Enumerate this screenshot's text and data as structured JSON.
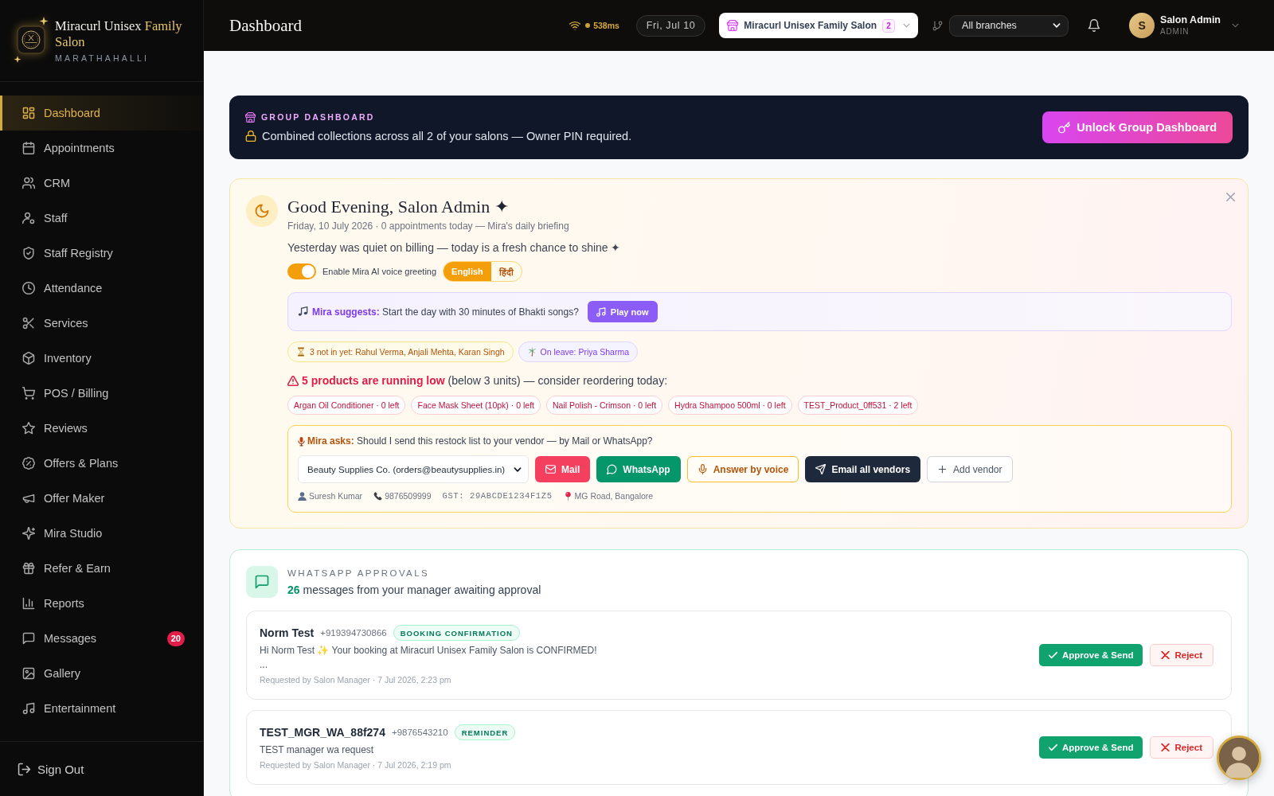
{
  "sidebar": {
    "brand": {
      "name": "Miracurl Unisex",
      "name_accent": "Family Salon",
      "location": "MARATHAHALLI"
    },
    "items": [
      {
        "label": "Dashboard",
        "selected": true
      },
      {
        "label": "Appointments",
        "selected": false
      },
      {
        "label": "CRM",
        "selected": false
      },
      {
        "label": "Staff",
        "selected": false
      },
      {
        "label": "Staff Registry",
        "selected": false
      },
      {
        "label": "Attendance",
        "selected": false
      },
      {
        "label": "Services",
        "selected": false
      },
      {
        "label": "Inventory",
        "selected": false
      },
      {
        "label": "POS / Billing",
        "selected": false
      },
      {
        "label": "Reviews",
        "selected": false
      },
      {
        "label": "Offers & Plans",
        "selected": false
      },
      {
        "label": "Offer Maker",
        "selected": false
      },
      {
        "label": "Mira Studio",
        "selected": false
      },
      {
        "label": "Refer & Earn",
        "selected": false
      },
      {
        "label": "Reports",
        "selected": false
      },
      {
        "label": "Messages",
        "selected": false,
        "badge": "20"
      },
      {
        "label": "Gallery",
        "selected": false
      },
      {
        "label": "Entertainment",
        "selected": false
      }
    ],
    "sign_out": "Sign Out"
  },
  "header": {
    "title": "Dashboard",
    "latency": "538ms",
    "date": "Fri, Jul 10",
    "salon": {
      "name": "Miracurl Unisex Family Salon",
      "count": "2"
    },
    "branch": "All branches",
    "user": {
      "initial": "S",
      "name": "Salon Admin",
      "role": "ADMIN"
    }
  },
  "group_banner": {
    "label": "GROUP DASHBOARD",
    "text": "Combined collections across all 2 of your salons — Owner PIN required.",
    "button": "Unlock Group Dashboard"
  },
  "briefing": {
    "title": "Good Evening, Salon Admin ✦",
    "subtitle": "Friday, 10 July 2026 · 0 appointments today — Mira's daily briefing",
    "message": "Yesterday was quiet on billing — today is a fresh chance to shine ✦",
    "voice_greeting": {
      "label": "Enable Mira AI voice greeting",
      "on": true
    },
    "languages": [
      {
        "label": "English",
        "selected": true
      },
      {
        "label": "हिंदी",
        "selected": false
      }
    ],
    "suggestion": {
      "text": "**Mira suggests:** Start the day with 30 minutes of Bhakti songs?",
      "button": "Play now"
    },
    "staff_notes": [
      {
        "kind": "late",
        "text": "3 not in yet: Rahul Verma, Anjali Mehta, Karan Singh"
      },
      {
        "kind": "leave",
        "text": "On leave: Priya Sharma"
      }
    ],
    "low_stock": {
      "text": "**5 products are running low** (below 3 units) — consider reordering today:",
      "products": [
        "Argan Oil Conditioner · 0 left",
        "Face Mask Sheet (10pk) · 0 left",
        "Nail Polish - Crimson · 0 left",
        "Hydra Shampoo 500ml · 0 left",
        "TEST_Product_0ff531 · 2 left"
      ]
    },
    "vendor_prompt": {
      "question": "**Mira asks:** Should I send this restock list to your vendor — by Mail or WhatsApp?",
      "vendor": "Beauty Supplies Co. (orders@beautysupplies.in)",
      "actions": [
        {
          "kind": "mail",
          "label": "Mail"
        },
        {
          "kind": "whatsapp",
          "label": "WhatsApp"
        },
        {
          "kind": "voice",
          "label": "Answer by voice"
        },
        {
          "kind": "email_all",
          "label": "Email all vendors"
        },
        {
          "kind": "add",
          "label": "Add vendor"
        }
      ],
      "contact": {
        "person": "Suresh Kumar",
        "phone": "9876509999",
        "gst": "GST: 29ABCDE1234F1Z5",
        "address": "MG Road, Bangalore"
      }
    }
  },
  "whatsapp_approvals": {
    "label": "WHATSAPP APPROVALS",
    "summary": "**26** messages from your manager awaiting approval",
    "messages": [
      {
        "name": "Norm Test",
        "phone": "+919394730866",
        "tag": "BOOKING CONFIRMATION",
        "body": "Hi Norm Test ✨ Your booking at Miracurl Unisex Family Salon is CONFIRMED!\n...",
        "meta": "Requested by Salon Manager · 7 Jul 2026, 2:23 pm",
        "approve": "Approve & Send",
        "reject": "Reject"
      },
      {
        "name": "TEST_MGR_WA_88f274",
        "phone": "+9876543210",
        "tag": "REMINDER",
        "body": "TEST manager wa request",
        "meta": "Requested by Salon Manager · 7 Jul 2026, 2:19 pm",
        "approve": "Approve & Send",
        "reject": "Reject"
      }
    ]
  }
}
